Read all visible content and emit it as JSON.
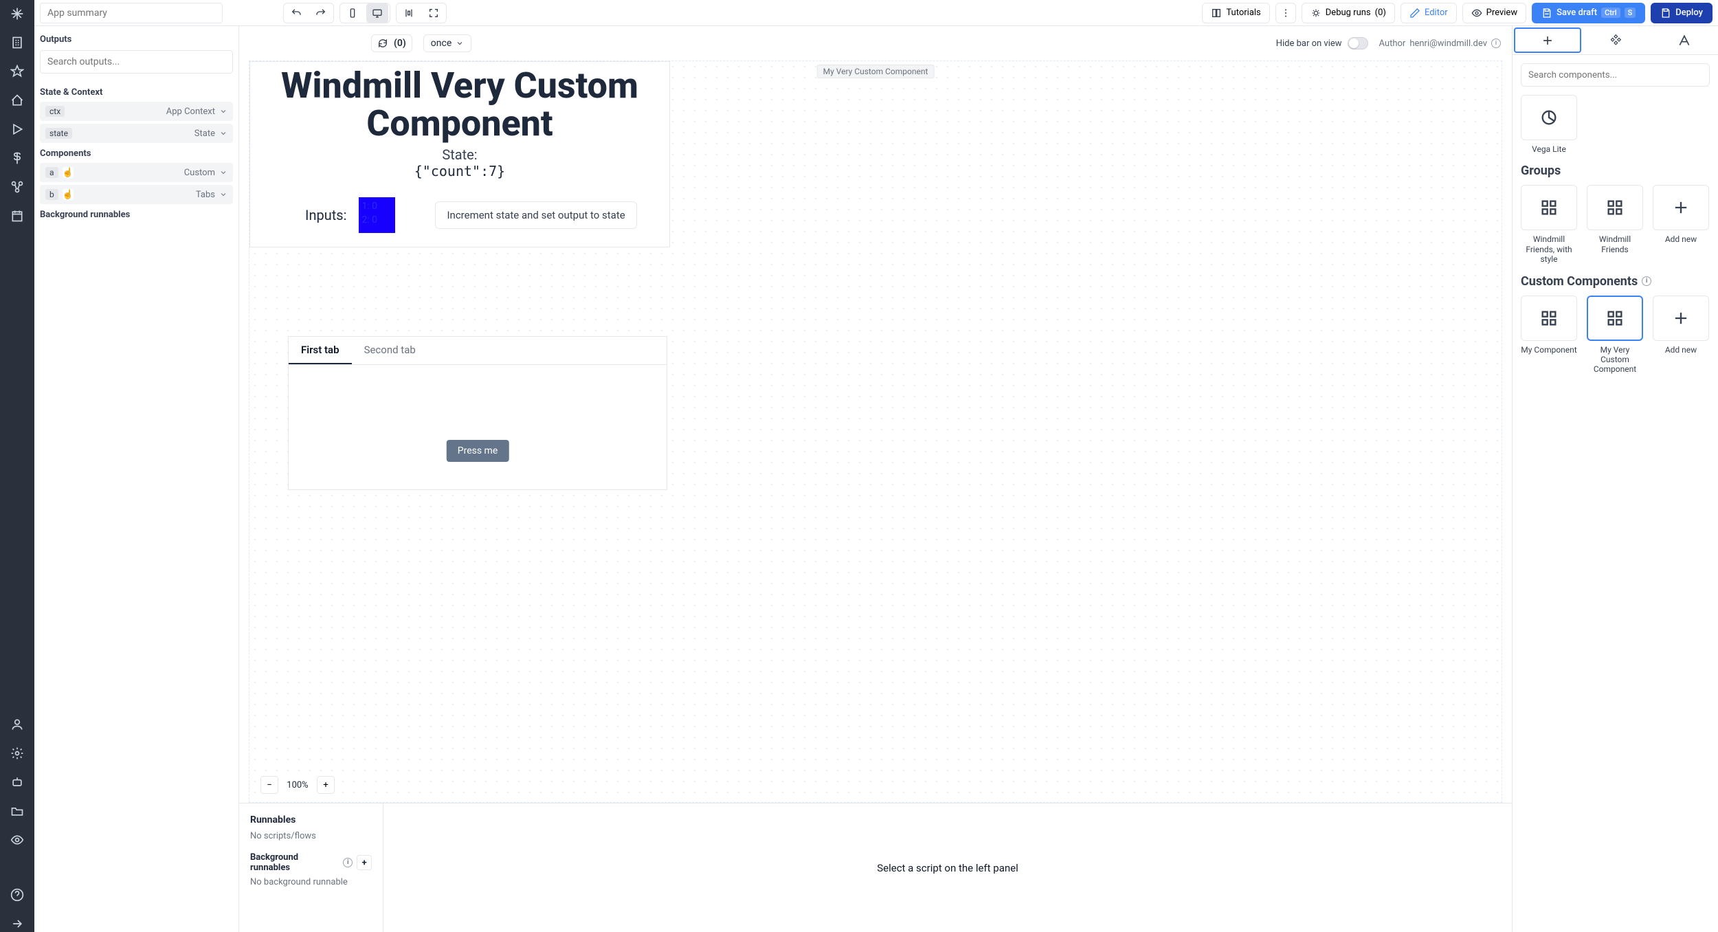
{
  "toolbar": {
    "app_summary_placeholder": "App summary",
    "tutorials": "Tutorials",
    "debug_runs": "Debug runs",
    "debug_runs_count": "(0)",
    "editor": "Editor",
    "preview": "Preview",
    "save_draft": "Save draft",
    "save_kbd1": "Ctrl",
    "save_kbd2": "S",
    "deploy": "Deploy"
  },
  "canvas_bar": {
    "refresh_count": "(0)",
    "run_mode": "once",
    "hide_bar": "Hide bar on view",
    "author_label": "Author",
    "author_email": "henri@windmill.dev",
    "tooltip": "My Very Custom Component"
  },
  "outputs": {
    "title": "Outputs",
    "search_placeholder": "Search outputs...",
    "state_context": "State & Context",
    "rows_sc": [
      {
        "tag": "ctx",
        "label": "App Context"
      },
      {
        "tag": "state",
        "label": "State"
      }
    ],
    "components": "Components",
    "rows_comp": [
      {
        "tag": "a",
        "label": "Custom"
      },
      {
        "tag": "b",
        "label": "Tabs"
      }
    ],
    "bg_runnables": "Background runnables"
  },
  "custom_component": {
    "title": "Windmill Very Custom Component",
    "state_label": "State:",
    "state_value": "{\"count\":7}",
    "inputs_label": "Inputs:",
    "box_line1": "1: 0",
    "box_line2": "2: 0",
    "increment_btn": "Increment state and set output to state"
  },
  "tabs_component": {
    "tab1": "First tab",
    "tab2": "Second tab",
    "press_me": "Press me"
  },
  "zoom": {
    "value": "100%"
  },
  "runnables": {
    "title": "Runnables",
    "empty": "No scripts/flows",
    "bg_title": "Background runnables",
    "bg_empty": "No background runnable",
    "right_hint": "Select a script on the left panel"
  },
  "right_panel": {
    "search_placeholder": "Search components...",
    "vega_lite": "Vega Lite",
    "groups": "Groups",
    "grp1": "Windmill Friends, with style",
    "grp2": "Windmill Friends",
    "add_new": "Add new",
    "custom_comps": "Custom Components",
    "cc1": "My Component",
    "cc2": "My Very Custom Component"
  }
}
